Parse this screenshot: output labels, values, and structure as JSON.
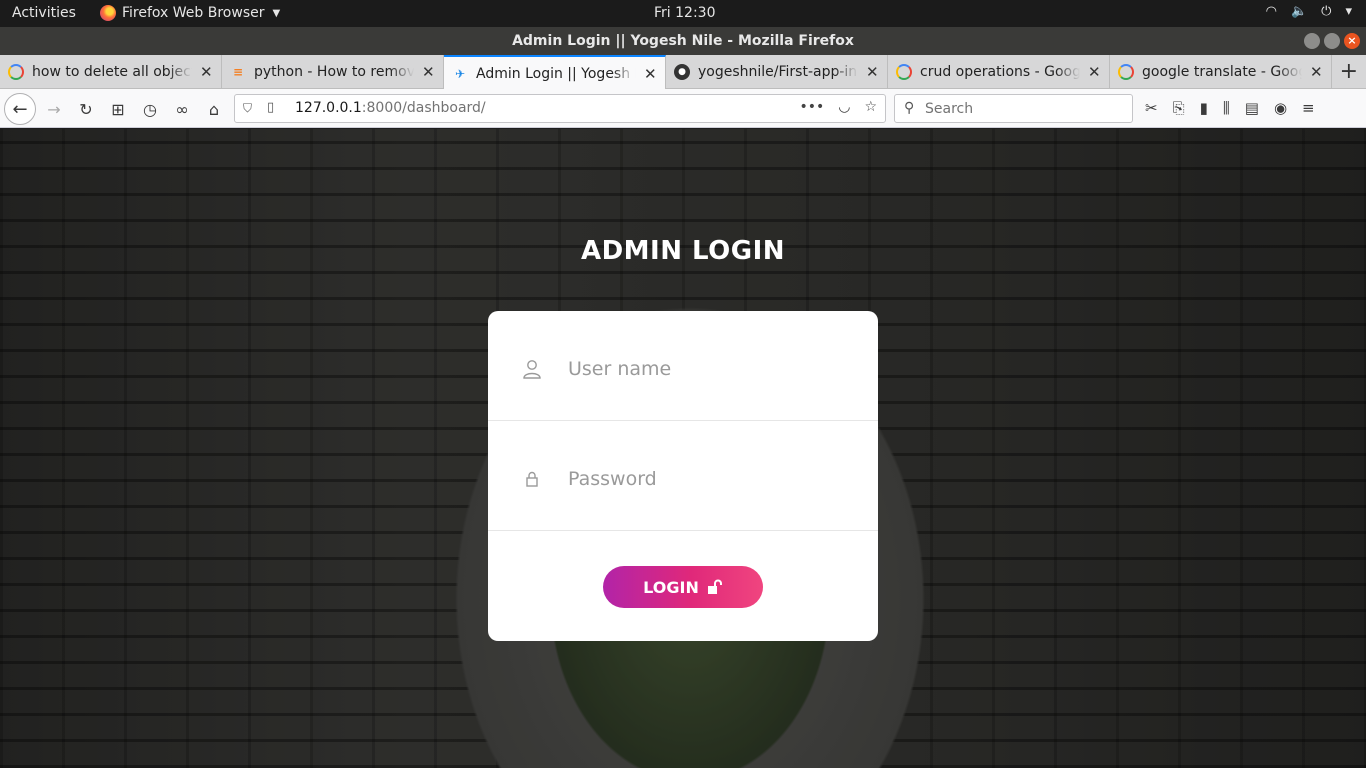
{
  "system_bar": {
    "activities": "Activities",
    "app_name": "Firefox Web Browser",
    "clock": "Fri 12:30"
  },
  "window": {
    "title": "Admin Login || Yogesh Nile - Mozilla Firefox"
  },
  "tabs": [
    {
      "label": "how to delete all objects",
      "favicon": "google-icon",
      "active": false
    },
    {
      "label": "python - How to remove",
      "favicon": "stackoverflow-icon",
      "active": false
    },
    {
      "label": "Admin Login || Yogesh Nile",
      "favicon": "django-icon",
      "active": true
    },
    {
      "label": "yogeshnile/First-app-in-Django",
      "favicon": "github-icon",
      "active": false
    },
    {
      "label": "crud operations - Google",
      "favicon": "google-icon",
      "active": false
    },
    {
      "label": "google translate - Google",
      "favicon": "google-icon",
      "active": false
    }
  ],
  "navbar": {
    "url_host": "127.0.0.1",
    "url_rest": ":8000/dashboard/",
    "search_placeholder": "Search"
  },
  "login": {
    "heading": "ADMIN LOGIN",
    "username_placeholder": "User name",
    "password_placeholder": "Password",
    "button_label": "LOGIN"
  },
  "colors": {
    "accent_tab": "#0a84ff",
    "button_gradient_start": "#b224a8",
    "button_gradient_end": "#f0457f",
    "close_button": "#e95420"
  }
}
